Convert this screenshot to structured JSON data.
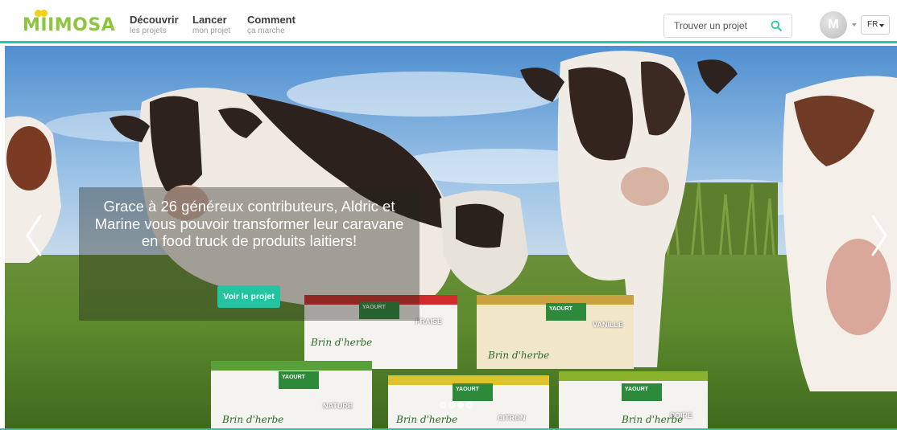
{
  "brand": {
    "name": "MIIMOSA",
    "color": "#8cc63f",
    "accent": "#29c6a4",
    "dot_color": "#f2d11a"
  },
  "nav": [
    {
      "label": "Découvrir",
      "sub": "les projets"
    },
    {
      "label": "Lancer",
      "sub": "mon projet"
    },
    {
      "label": "Comment",
      "sub": "ça marche"
    }
  ],
  "search": {
    "placeholder": "Trouver un projet",
    "icon": "search-icon"
  },
  "user": {
    "avatar_letter": "M",
    "icon": "caret-down-icon"
  },
  "language": {
    "value": "FR"
  },
  "hero": {
    "headline": "Grace à 26 généreux contributeurs, Aldric et Marine vous pouvoir transformer leur caravane en food truck de produits laitiers!",
    "cta_label": "Voir le projet",
    "prev_icon": "chevron-left-icon",
    "next_icon": "chevron-right-icon",
    "slides_count": 4,
    "active_slide": 3
  },
  "products": [
    {
      "line1": "YAOURT",
      "line2": "DE LA FERME",
      "flavor_count": "4 BRASSÉS",
      "flavor": "FRAISE",
      "brand": "Brin d'herbe"
    },
    {
      "line1": "YAOURT",
      "line2": "DE LA FERME",
      "flavor_count": "4 BRASSÉS",
      "flavor": "VANILLE",
      "brand": "Brin d'herbe"
    },
    {
      "line1": "YAOURT",
      "line2": "DE LA FERME",
      "flavor_count": "4 BRASSÉS",
      "flavor": "NATURE",
      "brand": "Brin d'herbe"
    },
    {
      "line1": "YAOURT",
      "line2": "DE LA FERME",
      "flavor_count": "4 BRASSÉS",
      "flavor": "CITRON",
      "brand": "Brin d'herbe"
    },
    {
      "line1": "YAOURT",
      "line2": "DE LA FERME",
      "flavor_count": "4 BRASSÉS",
      "flavor": "POIRE",
      "brand": "Brin d'herbe"
    }
  ]
}
